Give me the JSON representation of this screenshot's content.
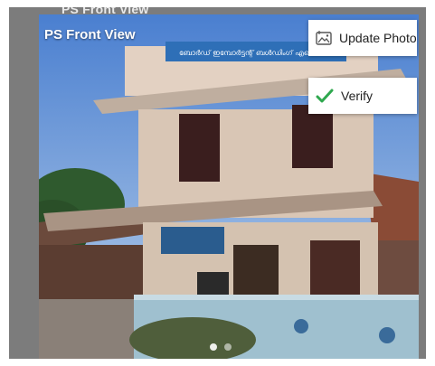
{
  "screen": {
    "header_title_clipped": "PS Front View",
    "photo_title": "PS Front View",
    "building_sign_text": "ബോർഡ് ഇമ്പോർട്ടന്റ് ബൾഡിംഗ് എലെക്ഷൻ"
  },
  "actions": {
    "update_photo_label": "Update Photo",
    "verify_label": "Verify",
    "update_photo_icon": "image-upload-icon",
    "verify_icon": "checkmark-icon",
    "verify_color": "#2fa84f"
  },
  "carousel": {
    "total_pages": 2,
    "current_page": 1
  }
}
